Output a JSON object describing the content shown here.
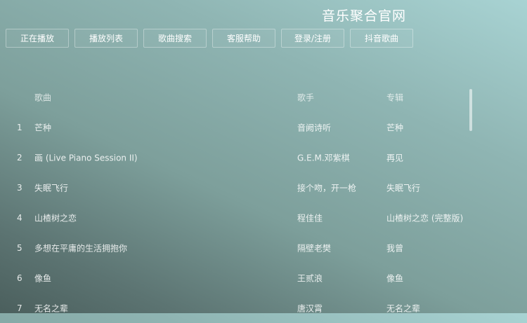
{
  "site": {
    "title": "音乐聚合官网"
  },
  "nav": [
    {
      "label": "正在播放"
    },
    {
      "label": "播放列表"
    },
    {
      "label": "歌曲搜索"
    },
    {
      "label": "客服帮助"
    },
    {
      "label": "登录/注册"
    },
    {
      "label": "抖音歌曲"
    }
  ],
  "table": {
    "headers": {
      "song": "歌曲",
      "artist": "歌手",
      "album": "专辑"
    },
    "rows": [
      {
        "index": "1",
        "song": "芒种",
        "artist": "音阙诗听",
        "album": "芒种"
      },
      {
        "index": "2",
        "song": "画 (Live Piano Session II)",
        "artist": "G.E.M.邓紫棋",
        "album": "再见"
      },
      {
        "index": "3",
        "song": "失眠飞行",
        "artist": "接个吻，开一枪",
        "album": "失眠飞行"
      },
      {
        "index": "4",
        "song": "山楂树之恋",
        "artist": "程佳佳",
        "album": "山楂树之恋 (完整版)"
      },
      {
        "index": "5",
        "song": "多想在平庸的生活拥抱你",
        "artist": "隔壁老樊",
        "album": "我曾"
      },
      {
        "index": "6",
        "song": "像鱼",
        "artist": "王贰浪",
        "album": "像鱼"
      },
      {
        "index": "7",
        "song": "无名之辈",
        "artist": "唐汉霄",
        "album": "无名之辈"
      }
    ]
  }
}
